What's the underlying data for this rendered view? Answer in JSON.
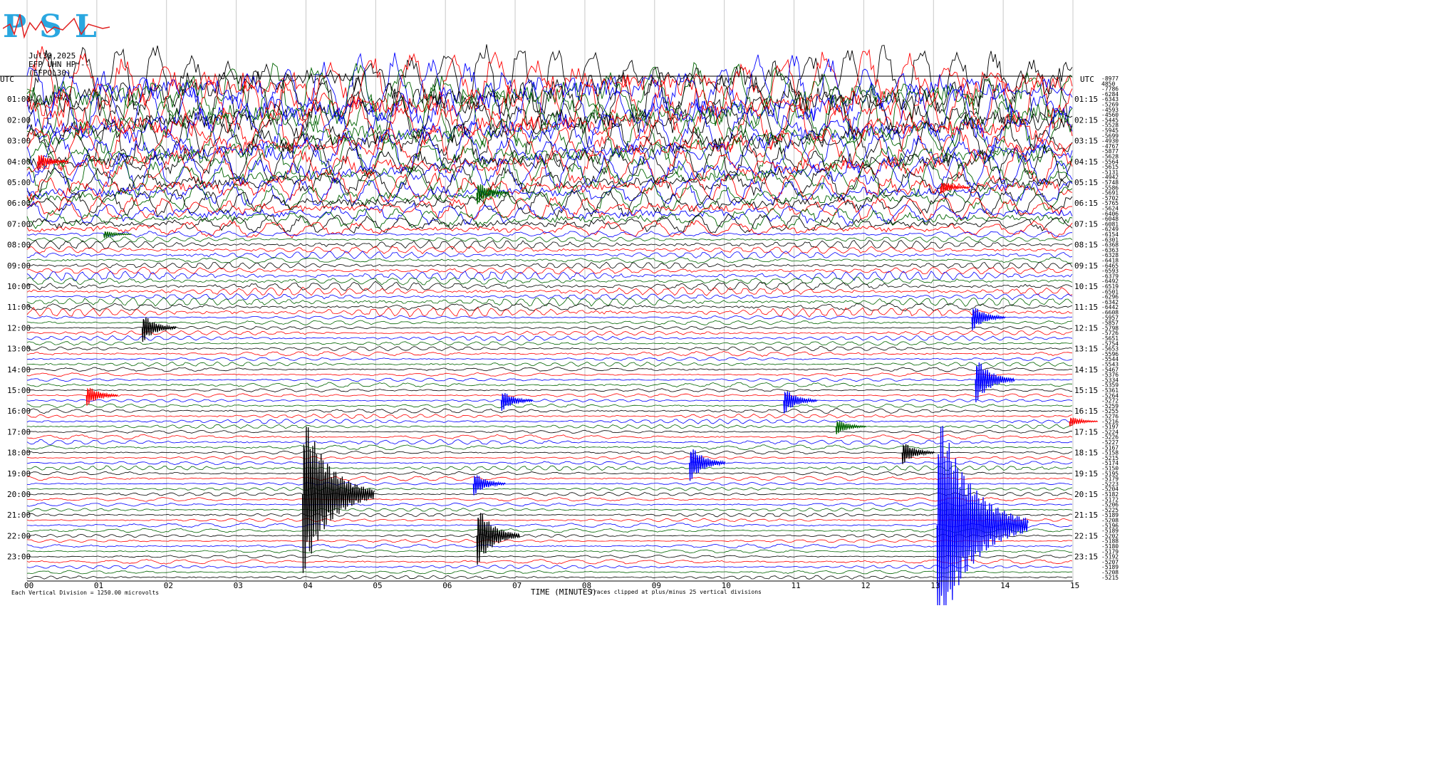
{
  "header": {
    "date": "Jul30,2025",
    "channel": "EFP UHN HP --",
    "network": "(EFPOL30)",
    "utc_left": "UTC",
    "utc_right": "UTC",
    "logo_text": "PSL"
  },
  "footer": {
    "scale": "Each Vertical Division = 1250.00 microvolts",
    "xlabel": "TIME (MINUTES)",
    "clip_note": "Traces clipped at plus/minus 25 vertical divisions"
  },
  "colors": {
    "black": "#000000",
    "red": "#ff0000",
    "blue": "#0000ff",
    "green": "#006400"
  },
  "chart_data": {
    "type": "line",
    "x_ticks": [
      "00",
      "01",
      "02",
      "03",
      "04",
      "05",
      "06",
      "07",
      "08",
      "09",
      "10",
      "11",
      "12",
      "13",
      "14",
      "15"
    ],
    "xlim": [
      0,
      15
    ],
    "rows_per_hour": 4,
    "hour_labels_left": [
      "01:00",
      "02:00",
      "03:00",
      "04:00",
      "05:00",
      "06:00",
      "07:00",
      "08:00",
      "09:00",
      "10:00",
      "11:00",
      "12:00",
      "13:00",
      "14:00",
      "15:00",
      "16:00",
      "17:00",
      "18:00",
      "19:00",
      "20:00",
      "21:00",
      "22:00",
      "23:00"
    ],
    "hour_labels_right": [
      "01:15",
      "02:15",
      "03:15",
      "04:15",
      "05:15",
      "06:15",
      "07:15",
      "08:15",
      "09:15",
      "10:15",
      "11:15",
      "12:15",
      "13:15",
      "14:15",
      "15:15",
      "16:15",
      "17:15",
      "18:15",
      "19:15",
      "20:15",
      "21:15",
      "22:15",
      "23:15"
    ],
    "row_offsets": [
      "-8977",
      "4850",
      "-7786",
      "-6284",
      "-6343",
      "-5269",
      "-4593",
      "-4560",
      "-5445",
      "-5528",
      "-5945",
      "-5699",
      "-4930",
      "-4767",
      "-5877",
      "-5628",
      "-5564",
      "-5615",
      "-5131",
      "-4942",
      "-5748",
      "-5586",
      "-5691",
      "-5702",
      "-5765",
      "-5624",
      "-6406",
      "-6048",
      "-6081",
      "-6249",
      "-6154",
      "-6301",
      "-6368",
      "-6363",
      "-6328",
      "-6418",
      "-6465",
      "-6593",
      "-6379",
      "-6492",
      "-6519",
      "-6501",
      "-6296",
      "-6342",
      "-6442",
      "-6608",
      "-5957",
      "-5857",
      "-5798",
      "-5726",
      "-5651",
      "-5754",
      "-5653",
      "-5596",
      "-5544",
      "-5543",
      "-5467",
      "-5376",
      "-5334",
      "-5359",
      "-5361",
      "-5264",
      "-5272",
      "-5259",
      "-5255",
      "-5276",
      "-5216",
      "-5197",
      "-5224",
      "-5226",
      "-5227",
      "-5167",
      "-5158",
      "-5215",
      "-5174",
      "-5150",
      "-5195",
      "-5179",
      "-5223",
      "-5204",
      "-5182",
      "-5172",
      "-5206",
      "-5225",
      "-5189",
      "-5208",
      "-5196",
      "-5189",
      "-5202",
      "-5188",
      "-5180",
      "-5179",
      "-5192",
      "-5207",
      "-5189",
      "-5208",
      "-5215"
    ],
    "events": [
      {
        "row": 16,
        "minute": 0.15,
        "amplitude": 14,
        "color": "red"
      },
      {
        "row": 22,
        "minute": 6.45,
        "amplitude": 18,
        "color": "green"
      },
      {
        "row": 21,
        "minute": 13.1,
        "amplitude": 10,
        "color": "red"
      },
      {
        "row": 30,
        "minute": 1.1,
        "amplitude": 6,
        "color": "green"
      },
      {
        "row": 48,
        "minute": 1.65,
        "amplitude": 22,
        "color": "black"
      },
      {
        "row": 61,
        "minute": 0.85,
        "amplitude": 16,
        "color": "red"
      },
      {
        "row": 62,
        "minute": 6.8,
        "amplitude": 16,
        "color": "blue"
      },
      {
        "row": 62,
        "minute": 10.85,
        "amplitude": 20,
        "color": "blue"
      },
      {
        "row": 46,
        "minute": 13.55,
        "amplitude": 20,
        "color": "blue"
      },
      {
        "row": 58,
        "minute": 13.6,
        "amplitude": 35,
        "color": "blue"
      },
      {
        "row": 67,
        "minute": 11.6,
        "amplitude": 12,
        "color": "green"
      },
      {
        "row": 66,
        "minute": 14.95,
        "amplitude": 8,
        "color": "red"
      },
      {
        "row": 72,
        "minute": 12.55,
        "amplitude": 18,
        "color": "black"
      },
      {
        "row": 74,
        "minute": 9.5,
        "amplitude": 28,
        "color": "blue"
      },
      {
        "row": 78,
        "minute": 6.4,
        "amplitude": 18,
        "color": "blue"
      },
      {
        "row": 80,
        "minute": 3.95,
        "amplitude": 120,
        "color": "black"
      },
      {
        "row": 88,
        "minute": 6.45,
        "amplitude": 45,
        "color": "black"
      },
      {
        "row": 86,
        "minute": 13.05,
        "amplitude": 170,
        "color": "blue"
      }
    ]
  }
}
